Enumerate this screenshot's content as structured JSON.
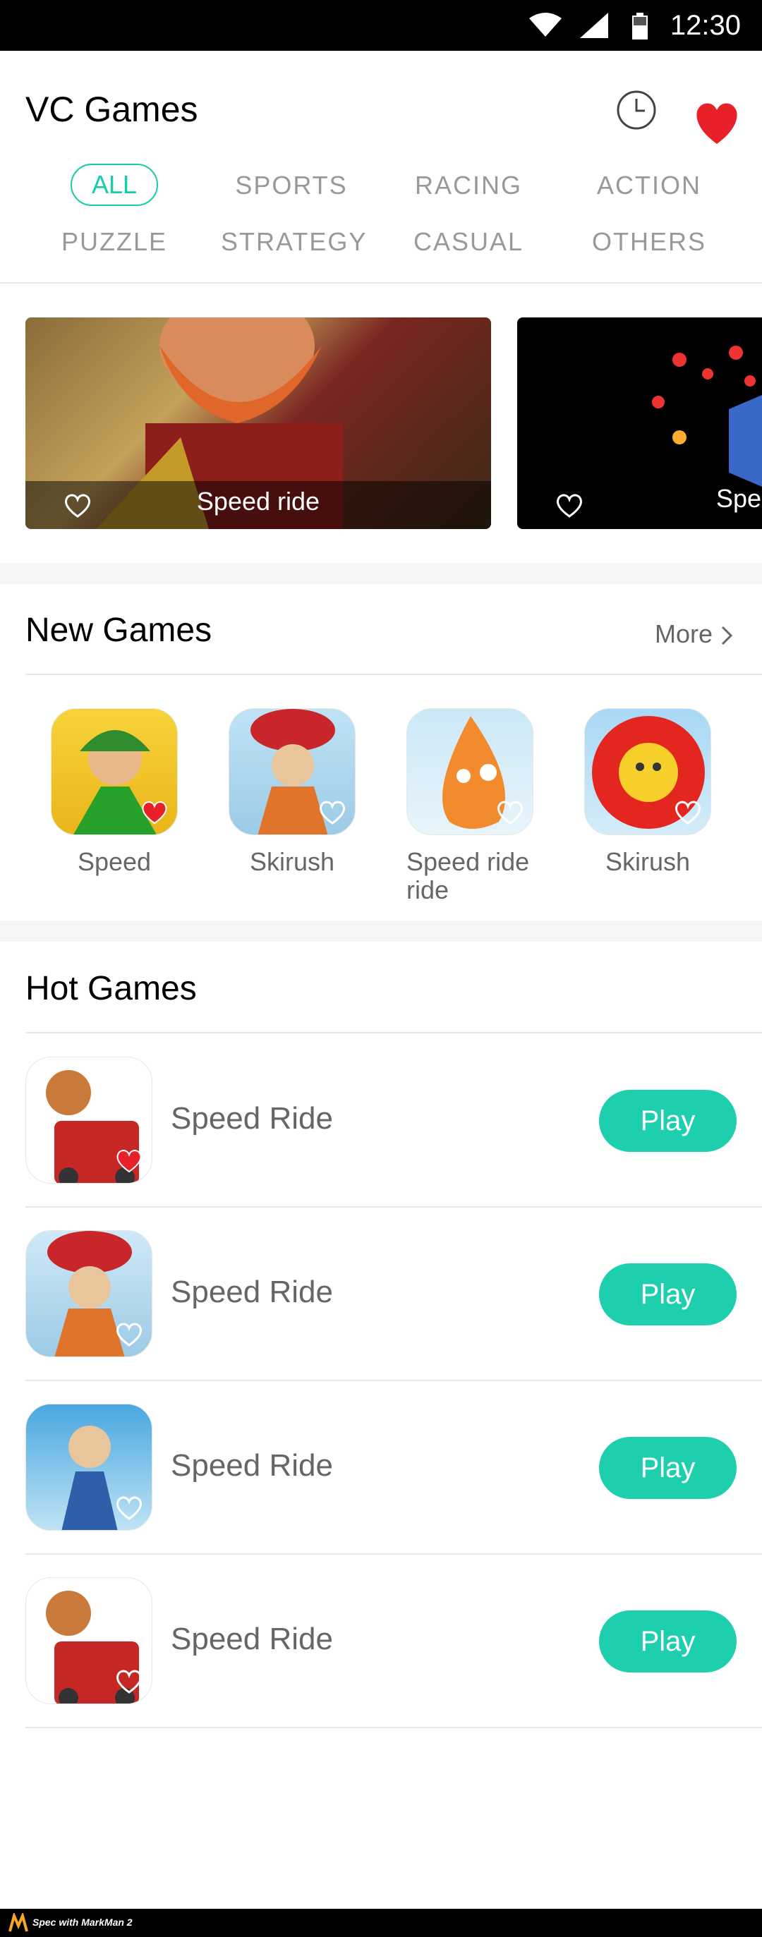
{
  "status_bar": {
    "time": "12:30"
  },
  "header": {
    "title": "VC Games",
    "categories": [
      "ALL",
      "SPORTS",
      "RACING",
      "ACTION",
      "PUZZLE",
      "STRATEGY",
      "CASUAL",
      "OTHERS"
    ],
    "selected_category": "ALL"
  },
  "banners": [
    {
      "title": "Speed ride",
      "favorited": false
    },
    {
      "title": "Spe",
      "favorited": false
    }
  ],
  "new_games": {
    "title": "New Games",
    "more_label": "More",
    "items": [
      {
        "label": "Speed",
        "favorited": true
      },
      {
        "label": "Skirush",
        "favorited": false
      },
      {
        "label": "Speed ride ride",
        "favorited": false
      },
      {
        "label": "Skirush",
        "favorited": false
      }
    ]
  },
  "hot_games": {
    "title": "Hot Games",
    "items": [
      {
        "name": "Speed Ride",
        "play_label": "Play",
        "favorited": true
      },
      {
        "name": "Speed Ride",
        "play_label": "Play",
        "favorited": false
      },
      {
        "name": "Speed Ride",
        "play_label": "Play",
        "favorited": false
      },
      {
        "name": "Speed Ride",
        "play_label": "Play",
        "favorited": false
      }
    ]
  },
  "footer_badge": "Spec with MarkMan 2",
  "colors": {
    "accent": "#13cfa7",
    "play_button": "#1ecfae",
    "heart": "#e8202a",
    "section_gap": "#f5f5f5",
    "divider": "#e7e7e7",
    "category_text": "#999999",
    "secondary_text": "#666666"
  },
  "icons": [
    "wifi-icon",
    "signal-icon",
    "battery-icon",
    "history-clock-icon",
    "heart-icon",
    "chevron-right-icon"
  ]
}
